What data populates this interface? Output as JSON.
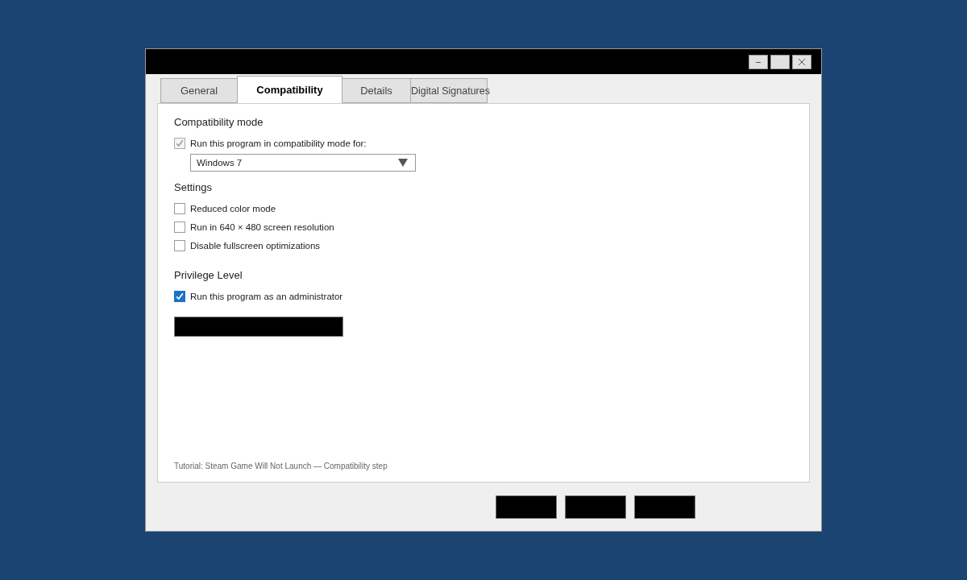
{
  "tabs": [
    {
      "label": "General",
      "selected": false
    },
    {
      "label": "Compatibility",
      "selected": true
    },
    {
      "label": "Details",
      "selected": false
    },
    {
      "label": "Digital Signatures",
      "selected": false
    }
  ],
  "sections": [
    {
      "heading": "Compatibility mode",
      "options": [
        {
          "label": "Run this program in compatibility mode for:",
          "checked": true,
          "disabled": true
        }
      ],
      "dropdown": {
        "value": "Windows 7"
      }
    },
    {
      "heading": "Settings",
      "options": [
        {
          "label": "Reduced color mode",
          "checked": false,
          "disabled": false
        },
        {
          "label": "Run in 640 × 480 screen resolution",
          "checked": false,
          "disabled": false
        },
        {
          "label": "Disable fullscreen optimizations",
          "checked": false,
          "disabled": false
        }
      ]
    },
    {
      "heading": "Privilege Level",
      "options": [
        {
          "label": "Run this program as an administrator",
          "checked": true,
          "disabled": false
        }
      ],
      "button": {
        "kind": "redacted"
      }
    }
  ],
  "footnote": "Tutorial: Steam Game Will Not Launch — Compatibility step",
  "dialog_buttons": [
    {
      "kind": "redacted"
    },
    {
      "kind": "redacted"
    },
    {
      "kind": "redacted"
    }
  ]
}
